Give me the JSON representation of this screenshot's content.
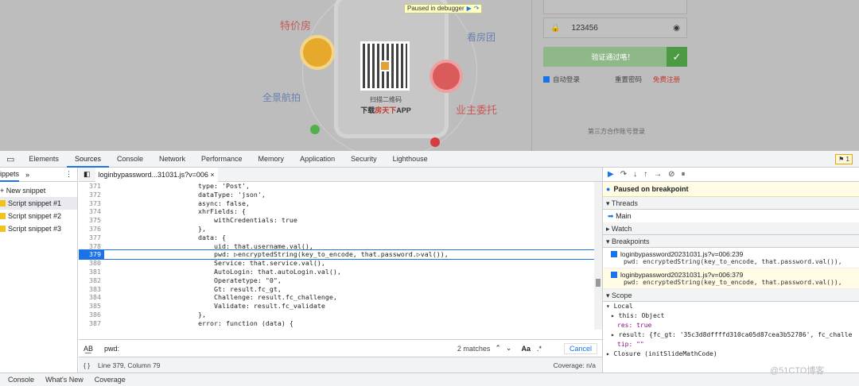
{
  "page": {
    "labels": {
      "special_price": "特价房",
      "see_house": "看房团",
      "panorama": "全景航拍",
      "owner": "业主委托"
    },
    "qr": {
      "scan": "扫描二维码",
      "download_prefix": "下载",
      "download_brand": "房天下",
      "download_suffix": "APP"
    },
    "paused_badge": "Paused in debugger",
    "form": {
      "password_value": "123456",
      "verify_button": "验证通过咯！",
      "auto_login": "自动登录",
      "reset_password": "重置密码",
      "register": "免费注册",
      "third_party": "第三方合作账号登录"
    }
  },
  "devtools": {
    "tabs": [
      "Elements",
      "Sources",
      "Console",
      "Network",
      "Performance",
      "Memory",
      "Application",
      "Security",
      "Lighthouse"
    ],
    "active_tab": "Sources",
    "issues_badge": "1",
    "snippets": {
      "header": "ippets",
      "new": "+ New snippet",
      "items": [
        "Script snippet #1",
        "Script snippet #2",
        "Script snippet #3"
      ]
    },
    "file_tab": "loginbypassword...31031.js?v=006",
    "code_lines": [
      {
        "n": "371",
        "t": "type: 'Post',"
      },
      {
        "n": "372",
        "t": "dataType: 'json',"
      },
      {
        "n": "373",
        "t": "async: false,"
      },
      {
        "n": "374",
        "t": "xhrFields: {"
      },
      {
        "n": "375",
        "t": "    withCredentials: true"
      },
      {
        "n": "376",
        "t": "},"
      },
      {
        "n": "377",
        "t": "data: {"
      },
      {
        "n": "378",
        "t": "    uid: that.username.val(),"
      },
      {
        "n": "379",
        "t": "    pwd: ▷encryptedString(key_to_encode, that.password.▷val()),"
      },
      {
        "n": "380",
        "t": "    Service: that.service.val(),"
      },
      {
        "n": "381",
        "t": "    AutoLogin: that.autoLogin.val(),"
      },
      {
        "n": "382",
        "t": "    Operatetype: \"0\","
      },
      {
        "n": "383",
        "t": "    Gt: result.fc_gt,"
      },
      {
        "n": "384",
        "t": "    Challenge: result.fc_challenge,"
      },
      {
        "n": "385",
        "t": "    Validate: result.fc_validate"
      },
      {
        "n": "386",
        "t": "},"
      },
      {
        "n": "387",
        "t": "error: function (data) {"
      }
    ],
    "search": {
      "query": "pwd:",
      "matches": "2 matches",
      "aa": "Aa",
      "regex": ".*",
      "cancel": "Cancel"
    },
    "status": {
      "position": "Line 379, Column 79",
      "coverage": "Coverage: n/a"
    },
    "debugger": {
      "paused": "Paused on breakpoint",
      "threads": "Threads",
      "main": "Main",
      "watch": "Watch",
      "breakpoints": "Breakpoints",
      "bps": [
        {
          "file": "loginbypassword20231031.js?v=006:239",
          "code": "pwd: encryptedString(key_to_encode, that.password.val()),"
        },
        {
          "file": "loginbypassword20231031.js?v=006:379",
          "code": "pwd: encryptedString(key_to_encode, that.password.val()),"
        }
      ],
      "scope": "Scope",
      "local": "Local",
      "scope_lines": [
        "▸ this: Object",
        "res: true",
        "▸ result: {fc_gt: '35c3d8dffffd310ca05d87cea3b52786', fc_challe",
        "tip: \"\"",
        "▸ Closure (initSlideMathCode)"
      ]
    },
    "drawer": [
      "Console",
      "What's New",
      "Coverage"
    ]
  },
  "watermark": "@51CTO博客"
}
